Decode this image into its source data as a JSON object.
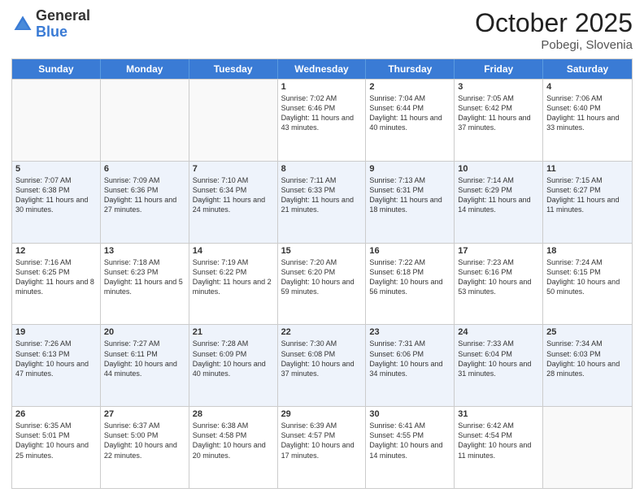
{
  "logo": {
    "general": "General",
    "blue": "Blue"
  },
  "header": {
    "month": "October 2025",
    "location": "Pobegi, Slovenia"
  },
  "days": [
    "Sunday",
    "Monday",
    "Tuesday",
    "Wednesday",
    "Thursday",
    "Friday",
    "Saturday"
  ],
  "weeks": [
    [
      {
        "day": "",
        "info": ""
      },
      {
        "day": "",
        "info": ""
      },
      {
        "day": "",
        "info": ""
      },
      {
        "day": "1",
        "info": "Sunrise: 7:02 AM\nSunset: 6:46 PM\nDaylight: 11 hours and 43 minutes."
      },
      {
        "day": "2",
        "info": "Sunrise: 7:04 AM\nSunset: 6:44 PM\nDaylight: 11 hours and 40 minutes."
      },
      {
        "day": "3",
        "info": "Sunrise: 7:05 AM\nSunset: 6:42 PM\nDaylight: 11 hours and 37 minutes."
      },
      {
        "day": "4",
        "info": "Sunrise: 7:06 AM\nSunset: 6:40 PM\nDaylight: 11 hours and 33 minutes."
      }
    ],
    [
      {
        "day": "5",
        "info": "Sunrise: 7:07 AM\nSunset: 6:38 PM\nDaylight: 11 hours and 30 minutes."
      },
      {
        "day": "6",
        "info": "Sunrise: 7:09 AM\nSunset: 6:36 PM\nDaylight: 11 hours and 27 minutes."
      },
      {
        "day": "7",
        "info": "Sunrise: 7:10 AM\nSunset: 6:34 PM\nDaylight: 11 hours and 24 minutes."
      },
      {
        "day": "8",
        "info": "Sunrise: 7:11 AM\nSunset: 6:33 PM\nDaylight: 11 hours and 21 minutes."
      },
      {
        "day": "9",
        "info": "Sunrise: 7:13 AM\nSunset: 6:31 PM\nDaylight: 11 hours and 18 minutes."
      },
      {
        "day": "10",
        "info": "Sunrise: 7:14 AM\nSunset: 6:29 PM\nDaylight: 11 hours and 14 minutes."
      },
      {
        "day": "11",
        "info": "Sunrise: 7:15 AM\nSunset: 6:27 PM\nDaylight: 11 hours and 11 minutes."
      }
    ],
    [
      {
        "day": "12",
        "info": "Sunrise: 7:16 AM\nSunset: 6:25 PM\nDaylight: 11 hours and 8 minutes."
      },
      {
        "day": "13",
        "info": "Sunrise: 7:18 AM\nSunset: 6:23 PM\nDaylight: 11 hours and 5 minutes."
      },
      {
        "day": "14",
        "info": "Sunrise: 7:19 AM\nSunset: 6:22 PM\nDaylight: 11 hours and 2 minutes."
      },
      {
        "day": "15",
        "info": "Sunrise: 7:20 AM\nSunset: 6:20 PM\nDaylight: 10 hours and 59 minutes."
      },
      {
        "day": "16",
        "info": "Sunrise: 7:22 AM\nSunset: 6:18 PM\nDaylight: 10 hours and 56 minutes."
      },
      {
        "day": "17",
        "info": "Sunrise: 7:23 AM\nSunset: 6:16 PM\nDaylight: 10 hours and 53 minutes."
      },
      {
        "day": "18",
        "info": "Sunrise: 7:24 AM\nSunset: 6:15 PM\nDaylight: 10 hours and 50 minutes."
      }
    ],
    [
      {
        "day": "19",
        "info": "Sunrise: 7:26 AM\nSunset: 6:13 PM\nDaylight: 10 hours and 47 minutes."
      },
      {
        "day": "20",
        "info": "Sunrise: 7:27 AM\nSunset: 6:11 PM\nDaylight: 10 hours and 44 minutes."
      },
      {
        "day": "21",
        "info": "Sunrise: 7:28 AM\nSunset: 6:09 PM\nDaylight: 10 hours and 40 minutes."
      },
      {
        "day": "22",
        "info": "Sunrise: 7:30 AM\nSunset: 6:08 PM\nDaylight: 10 hours and 37 minutes."
      },
      {
        "day": "23",
        "info": "Sunrise: 7:31 AM\nSunset: 6:06 PM\nDaylight: 10 hours and 34 minutes."
      },
      {
        "day": "24",
        "info": "Sunrise: 7:33 AM\nSunset: 6:04 PM\nDaylight: 10 hours and 31 minutes."
      },
      {
        "day": "25",
        "info": "Sunrise: 7:34 AM\nSunset: 6:03 PM\nDaylight: 10 hours and 28 minutes."
      }
    ],
    [
      {
        "day": "26",
        "info": "Sunrise: 6:35 AM\nSunset: 5:01 PM\nDaylight: 10 hours and 25 minutes."
      },
      {
        "day": "27",
        "info": "Sunrise: 6:37 AM\nSunset: 5:00 PM\nDaylight: 10 hours and 22 minutes."
      },
      {
        "day": "28",
        "info": "Sunrise: 6:38 AM\nSunset: 4:58 PM\nDaylight: 10 hours and 20 minutes."
      },
      {
        "day": "29",
        "info": "Sunrise: 6:39 AM\nSunset: 4:57 PM\nDaylight: 10 hours and 17 minutes."
      },
      {
        "day": "30",
        "info": "Sunrise: 6:41 AM\nSunset: 4:55 PM\nDaylight: 10 hours and 14 minutes."
      },
      {
        "day": "31",
        "info": "Sunrise: 6:42 AM\nSunset: 4:54 PM\nDaylight: 10 hours and 11 minutes."
      },
      {
        "day": "",
        "info": ""
      }
    ]
  ]
}
